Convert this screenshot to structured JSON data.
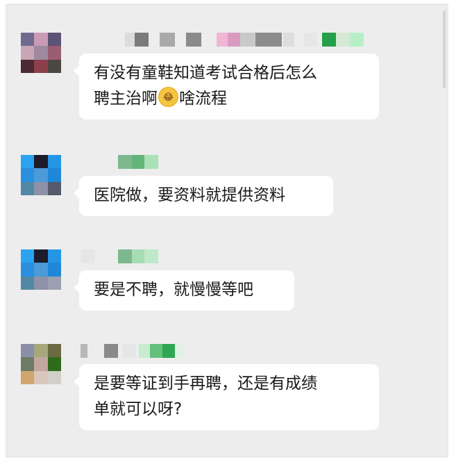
{
  "chat": {
    "messages": [
      {
        "lines": [
          "有没有童鞋知道考试合格后怎么",
          "聘主治啊",
          "啥流程"
        ],
        "emoji": "crying-laughing-emoji"
      },
      {
        "lines": [
          "医院做，要资料就提供资料"
        ]
      },
      {
        "lines": [
          "要是不聘，就慢慢等吧"
        ]
      },
      {
        "lines": [
          "是要等证到手再聘，还是有成绩",
          "单就可以呀?"
        ]
      }
    ]
  },
  "colors": {
    "chat_background": "#ededed",
    "bubble_background": "#ffffff",
    "text": "#191919"
  }
}
